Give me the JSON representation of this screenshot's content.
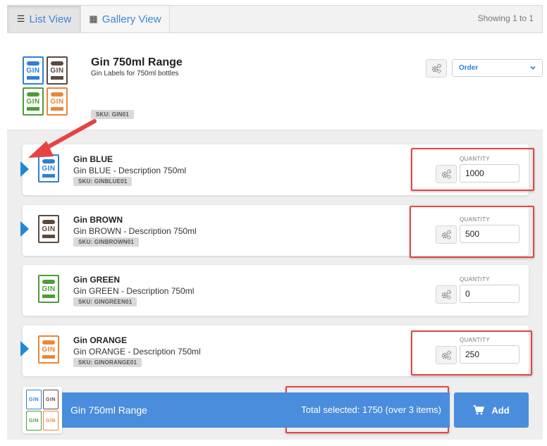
{
  "viewbar": {
    "list_label": "List View",
    "gallery_label": "Gallery View",
    "showing": "Showing 1 to 1"
  },
  "product": {
    "title": "Gin 750ml Range",
    "subtitle": "Gin Labels for 750ml bottles",
    "sku": "SKU: GIN01",
    "order_label": "Order",
    "label_text": "GIN"
  },
  "items": [
    {
      "title": "Gin BLUE",
      "desc": "Gin BLUE - Description 750ml",
      "sku": "SKU: GINBLUE01",
      "qty_label": "QUANTITY",
      "qty": "1000",
      "color": "#2f7fd6"
    },
    {
      "title": "Gin BROWN",
      "desc": "Gin BROWN - Description 750ml",
      "sku": "SKU: GINBROWN01",
      "qty_label": "QUANTITY",
      "qty": "500",
      "color": "#5b4a3f"
    },
    {
      "title": "Gin GREEN",
      "desc": "Gin GREEN - Description 750ml",
      "sku": "SKU: GINGREEN01",
      "qty_label": "QUANTITY",
      "qty": "0",
      "color": "#4f9b3a"
    },
    {
      "title": "Gin ORANGE",
      "desc": "Gin ORANGE - Description 750ml",
      "sku": "SKU: GINORANGE01",
      "qty_label": "QUANTITY",
      "qty": "250",
      "color": "#e8883a"
    }
  ],
  "bottom": {
    "name": "Gin 750ml Range",
    "total": "Total selected: 1750 (over 3 items)",
    "add_label": "Add"
  },
  "colors": {
    "accent": "#4a8ddc",
    "highlight": "#e54444",
    "pointer": "#1e88d4"
  }
}
